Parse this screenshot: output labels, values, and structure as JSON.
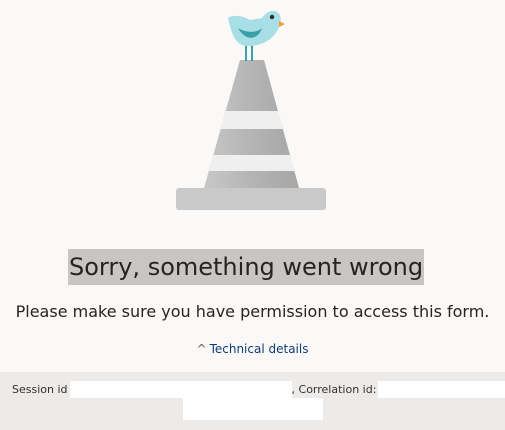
{
  "error": {
    "title": "Sorry, something went wrong",
    "message": "Please make sure you have permission to access this form."
  },
  "technical_details": {
    "toggle_label": "Technical details",
    "session_label": "Session id",
    "correlation_label": ", Correlation id:",
    "session_value": "",
    "correlation_value": ""
  },
  "colors": {
    "background": "#faf9f8",
    "link": "#0f3c78",
    "panel": "#edebe9",
    "highlight": "#c8c6c4"
  },
  "icons": {
    "illustration": "traffic-cone-with-bird"
  }
}
